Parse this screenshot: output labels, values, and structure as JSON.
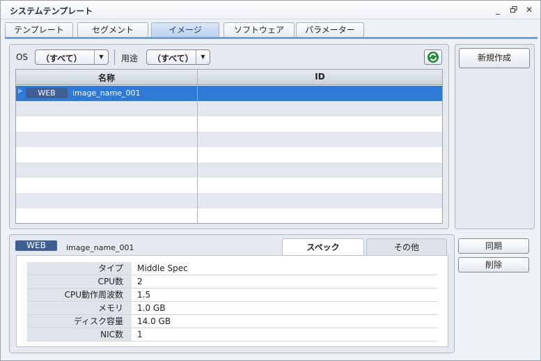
{
  "window": {
    "title": "システムテンプレート"
  },
  "tabs": [
    {
      "label": "テンプレート"
    },
    {
      "label": "セグメント"
    },
    {
      "label": "イメージ"
    },
    {
      "label": "ソフトウェア"
    },
    {
      "label": "パラメーター"
    }
  ],
  "filters": {
    "os_label": "OS",
    "os_value": "（すべて）",
    "usage_label": "用途",
    "usage_value": "（すべて）"
  },
  "grid": {
    "columns": [
      "名称",
      "ID"
    ],
    "rows": [
      {
        "tag": "WEB",
        "name": "image_name_001",
        "id": ""
      }
    ]
  },
  "side": {
    "new_button": "新規作成"
  },
  "detail": {
    "tag": "WEB",
    "name": "image_name_001",
    "tabs": [
      "スペック",
      "その他"
    ],
    "sync_button": "同期",
    "delete_button": "削除",
    "spec": [
      {
        "key": "タイプ",
        "value": "Middle Spec"
      },
      {
        "key": "CPU数",
        "value": "2"
      },
      {
        "key": "CPU動作周波数",
        "value": "1.5"
      },
      {
        "key": "メモリ",
        "value": "1.0 GB"
      },
      {
        "key": "ディスク容量",
        "value": "14.0 GB"
      },
      {
        "key": "NIC数",
        "value": "1"
      }
    ]
  },
  "colors": {
    "selected_row": "#2f7ad6",
    "tag_badge": "#3f5f94",
    "active_tab": "#b9d0ee"
  }
}
